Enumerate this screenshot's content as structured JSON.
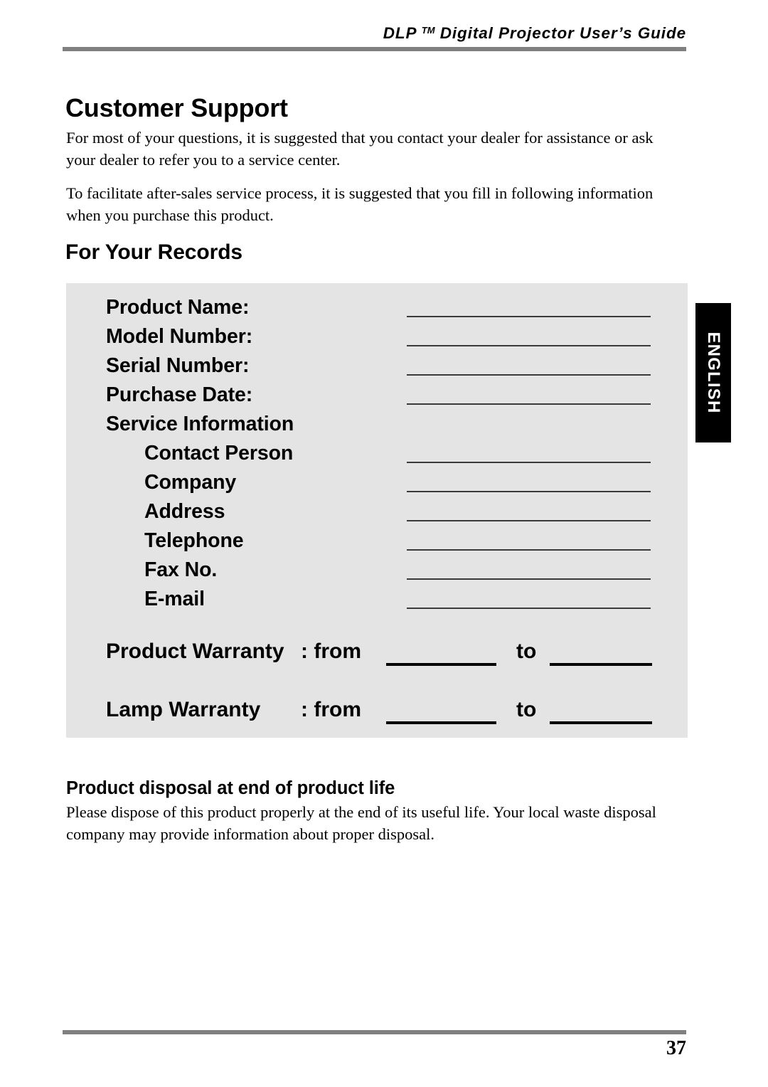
{
  "header": {
    "brand": "DLP",
    "trademark": "TM",
    "title": "Digital  Projector  User’s  Guide"
  },
  "page_title": "Customer Support",
  "paragraphs": {
    "intro": "For most of your questions, it is suggested that you contact your dealer for assistance or ask your dealer to refer you to a service center.",
    "facilitate": "To facilitate after-sales service process, it is suggested that you fill in following information when you purchase this product."
  },
  "records": {
    "heading": "For Your Records",
    "fields": [
      {
        "label": "Product Name:",
        "level": 1,
        "line": true
      },
      {
        "label": "Model Number:",
        "level": 1,
        "line": true
      },
      {
        "label": "Serial Number:",
        "level": 1,
        "line": true
      },
      {
        "label": "Purchase Date:",
        "level": 1,
        "line": true
      },
      {
        "label": "Service Information",
        "level": 1,
        "line": false
      },
      {
        "label": "Contact Person",
        "level": 2,
        "line": true
      },
      {
        "label": "Company",
        "level": 2,
        "line": true
      },
      {
        "label": "Address",
        "level": 2,
        "line": true
      },
      {
        "label": "Telephone",
        "level": 2,
        "line": true
      },
      {
        "label": "Fax No.",
        "level": 2,
        "line": true
      },
      {
        "label": "E-mail",
        "level": 2,
        "line": true
      }
    ],
    "warranties": [
      {
        "label": "Product Warranty",
        "from_label": ": from",
        "to_label": "to"
      },
      {
        "label": "Lamp Warranty",
        "from_label": ": from",
        "to_label": "to"
      }
    ]
  },
  "side_tab": {
    "label": "ENGLISH"
  },
  "disposal": {
    "heading": "Product disposal at end of product life",
    "body": "Please dispose of this product properly at the end of its useful life. Your local waste disposal company may provide information about proper disposal."
  },
  "footer": {
    "page_number": "37"
  },
  "colors": {
    "rule": "#808080",
    "panel": "#e4e4e4",
    "tab": "#000000",
    "field_line": "#3a3a3a"
  }
}
